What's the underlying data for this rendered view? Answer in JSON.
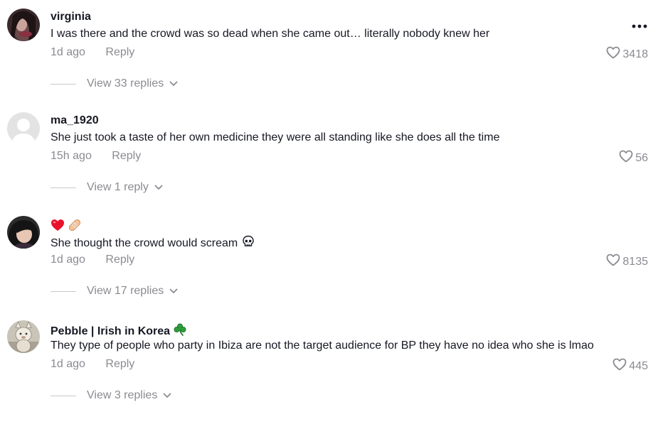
{
  "comments": [
    {
      "username": "virginia",
      "text": "I was there and the crowd was so dead when she came out… literally nobody knew her",
      "time": "1d ago",
      "reply_label": "Reply",
      "likes": "3418",
      "view_replies": "View 33 replies"
    },
    {
      "username": "ma_1920",
      "text": "She just took a taste of her own medicine they were all standing like she does all the time",
      "time": "15h ago",
      "reply_label": "Reply",
      "likes": "56",
      "view_replies": "View 1 reply"
    },
    {
      "username": "",
      "username_icons": [
        "red-heart-icon",
        "bandage-icon"
      ],
      "text": "She thought the crowd would scream",
      "text_icon": "skull-icon",
      "time": "1d ago",
      "reply_label": "Reply",
      "likes": "8135",
      "view_replies": "View 17 replies"
    },
    {
      "username": "Pebble | Irish in Korea",
      "username_icon": "shamrock-icon",
      "text": "They type of people who party in Ibiza are not the target audience for BP they have no idea who she is lmao",
      "time": "1d ago",
      "reply_label": "Reply",
      "likes": "445",
      "view_replies": "View 3 replies"
    }
  ],
  "colors": {
    "primary_text": "#161823",
    "secondary_text": "#8a8b91",
    "heart_red": "#e8132b"
  }
}
